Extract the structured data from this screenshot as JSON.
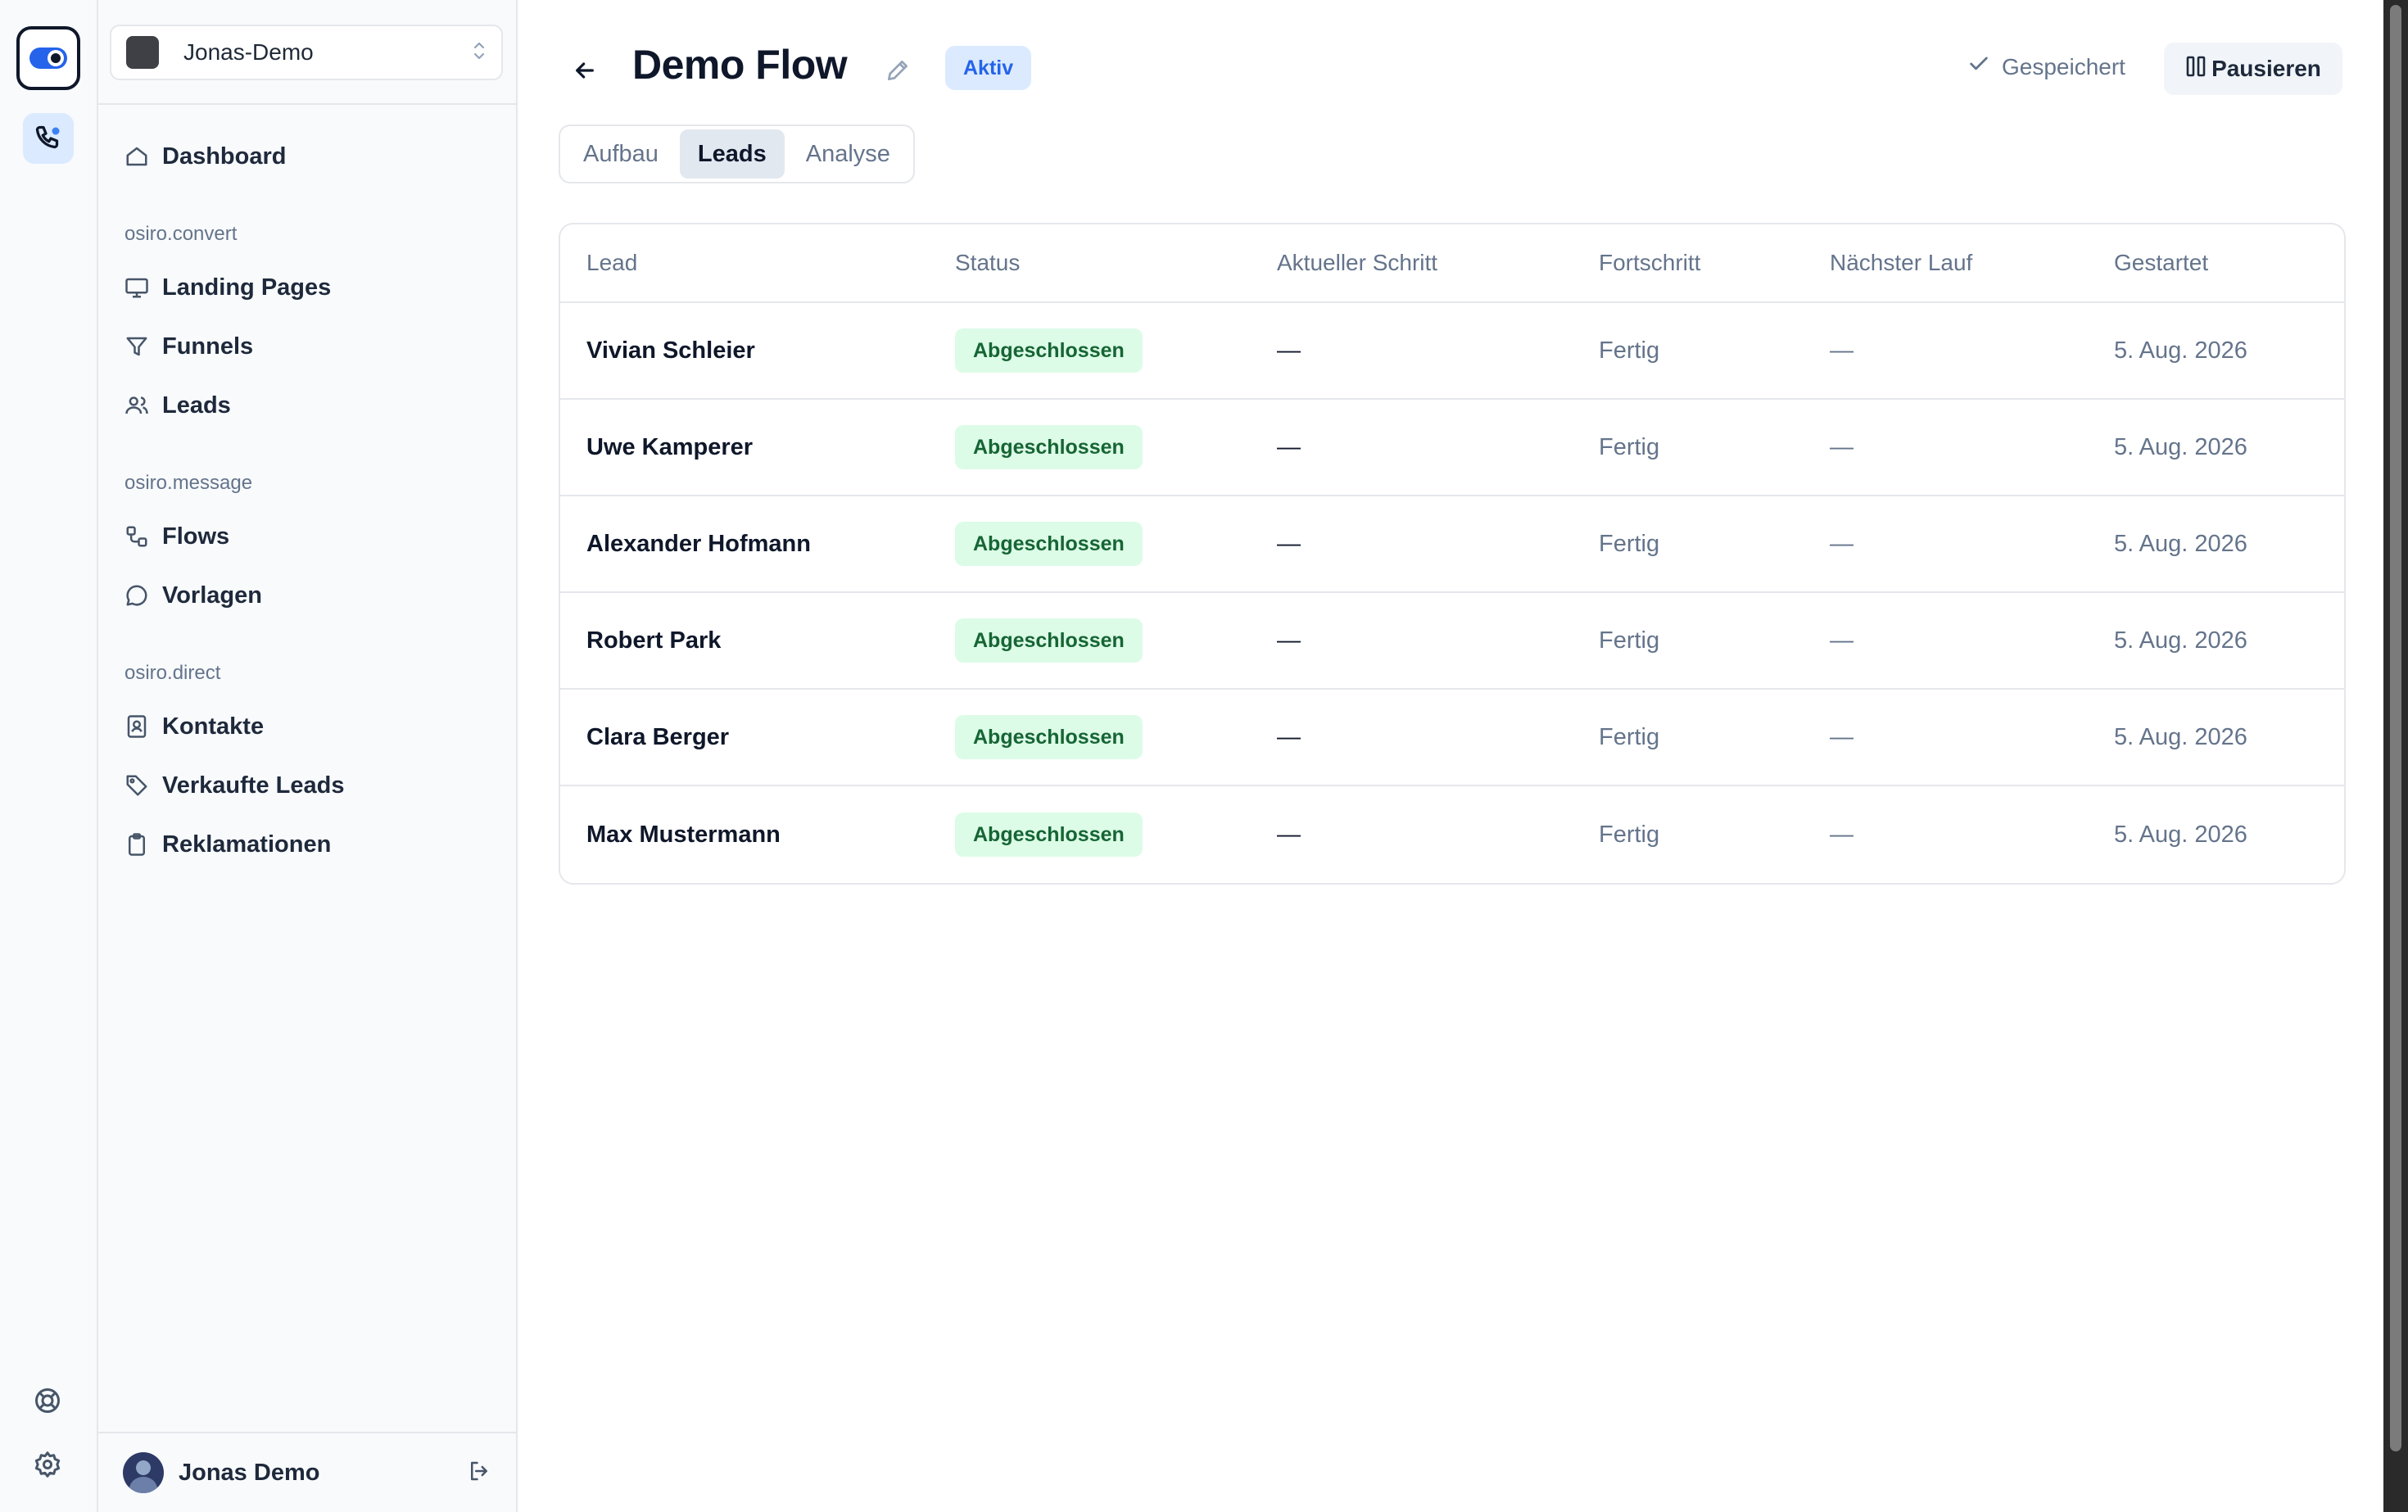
{
  "workspace": {
    "name": "Jonas-Demo"
  },
  "sidebar": {
    "dashboard": "Dashboard",
    "sections": [
      {
        "title": "osiro.convert",
        "items": [
          "Landing Pages",
          "Funnels",
          "Leads"
        ]
      },
      {
        "title": "osiro.message",
        "items": [
          "Flows",
          "Vorlagen"
        ]
      },
      {
        "title": "osiro.direct",
        "items": [
          "Kontakte",
          "Verkaufte Leads",
          "Reklamationen"
        ]
      }
    ],
    "user": "Jonas Demo"
  },
  "header": {
    "title": "Demo Flow",
    "status": "Aktiv",
    "saved": "Gespeichert",
    "pause": "Pausieren"
  },
  "tabs": [
    "Aufbau",
    "Leads",
    "Analyse"
  ],
  "active_tab": "Leads",
  "table": {
    "columns": [
      "Lead",
      "Status",
      "Aktueller Schritt",
      "Fortschritt",
      "Nächster Lauf",
      "Gestartet"
    ],
    "rows": [
      {
        "lead": "Vivian Schleier",
        "status": "Abgeschlossen",
        "step": "—",
        "progress": "Fertig",
        "next": "—",
        "started": "5. Aug. 2026"
      },
      {
        "lead": "Uwe Kamperer",
        "status": "Abgeschlossen",
        "step": "—",
        "progress": "Fertig",
        "next": "—",
        "started": "5. Aug. 2026"
      },
      {
        "lead": "Alexander Hofmann",
        "status": "Abgeschlossen",
        "step": "—",
        "progress": "Fertig",
        "next": "—",
        "started": "5. Aug. 2026"
      },
      {
        "lead": "Robert Park",
        "status": "Abgeschlossen",
        "step": "—",
        "progress": "Fertig",
        "next": "—",
        "started": "5. Aug. 2026"
      },
      {
        "lead": "Clara Berger",
        "status": "Abgeschlossen",
        "step": "—",
        "progress": "Fertig",
        "next": "—",
        "started": "5. Aug. 2026"
      },
      {
        "lead": "Max Mustermann",
        "status": "Abgeschlossen",
        "step": "—",
        "progress": "Fertig",
        "next": "—",
        "started": "5. Aug. 2026"
      }
    ]
  },
  "colors": {
    "accent": "#2563eb",
    "status_active_bg": "#dbeafe",
    "completed_bg": "#dcfce7",
    "completed_text": "#166534"
  }
}
